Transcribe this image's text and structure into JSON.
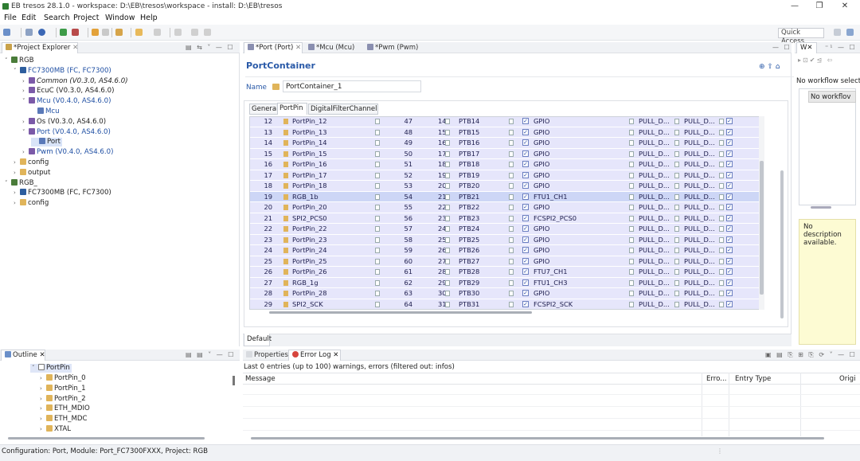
{
  "window": {
    "title": "EB tresos 28.1.0 - workspace: D:\\EB\\tresos\\workspace - install: D:\\EB\\tresos"
  },
  "menu": [
    "File",
    "Edit",
    "Search",
    "Project",
    "Window",
    "Help"
  ],
  "toolbar": {
    "quick_access": "Quick Access"
  },
  "explorer": {
    "tab": "*Project Explorer",
    "tree": [
      {
        "label": "RGB",
        "depth": 0,
        "arrow": "˅",
        "style": "normal"
      },
      {
        "label": "FC7300MB (FC, FC7300)",
        "depth": 1,
        "arrow": "˅",
        "style": "blue"
      },
      {
        "label": "Common (V0.3.0, AS4.6.0)",
        "depth": 2,
        "arrow": "›",
        "style": "italic"
      },
      {
        "label": "EcuC (V0.3.0, AS4.6.0)",
        "depth": 2,
        "arrow": "›",
        "style": "normal"
      },
      {
        "label": "Mcu (V0.4.0, AS4.6.0)",
        "depth": 2,
        "arrow": "˅",
        "style": "blue"
      },
      {
        "label": "Mcu",
        "depth": 3,
        "arrow": "",
        "style": "blue"
      },
      {
        "label": "Os (V0.3.0, AS4.6.0)",
        "depth": 2,
        "arrow": "›",
        "style": "normal"
      },
      {
        "label": "Port (V0.4.0, AS4.6.0)",
        "depth": 2,
        "arrow": "˅",
        "style": "blue"
      },
      {
        "label": "Port",
        "depth": 3,
        "arrow": "",
        "style": "selected"
      },
      {
        "label": "Pwm (V0.4.0, AS4.6.0)",
        "depth": 2,
        "arrow": "›",
        "style": "blue"
      },
      {
        "label": "config",
        "depth": 1,
        "arrow": "›",
        "style": "normal"
      },
      {
        "label": "output",
        "depth": 1,
        "arrow": "›",
        "style": "normal"
      },
      {
        "label": "RGB_",
        "depth": 0,
        "arrow": "˅",
        "style": "normal"
      },
      {
        "label": "FC7300MB (FC, FC7300)",
        "depth": 1,
        "arrow": "›",
        "style": "normal"
      },
      {
        "label": "config",
        "depth": 1,
        "arrow": "›",
        "style": "normal"
      }
    ]
  },
  "editor_tabs": [
    "*Port (Port)",
    "*Mcu (Mcu)",
    "*Pwm (Pwm)"
  ],
  "editor": {
    "heading": "PortContainer",
    "name_label": "Name",
    "name_value": "PortContainer_1",
    "subtabs": [
      "General",
      "PortPin",
      "DigitalFilterChannel"
    ],
    "footer_tab": "Default",
    "rows": [
      {
        "idx": "12",
        "name": "PortPin_12",
        "id": "47",
        "pin": "14",
        "port": "PTB14",
        "mode": "GPIO",
        "pull1": "PULL_D...",
        "pull2": "PULL_D..."
      },
      {
        "idx": "13",
        "name": "PortPin_13",
        "id": "48",
        "pin": "15",
        "port": "PTB15",
        "mode": "GPIO",
        "pull1": "PULL_D...",
        "pull2": "PULL_D..."
      },
      {
        "idx": "14",
        "name": "PortPin_14",
        "id": "49",
        "pin": "16",
        "port": "PTB16",
        "mode": "GPIO",
        "pull1": "PULL_D...",
        "pull2": "PULL_D..."
      },
      {
        "idx": "15",
        "name": "PortPin_15",
        "id": "50",
        "pin": "17",
        "port": "PTB17",
        "mode": "GPIO",
        "pull1": "PULL_D...",
        "pull2": "PULL_D..."
      },
      {
        "idx": "16",
        "name": "PortPin_16",
        "id": "51",
        "pin": "18",
        "port": "PTB18",
        "mode": "GPIO",
        "pull1": "PULL_D...",
        "pull2": "PULL_D..."
      },
      {
        "idx": "17",
        "name": "PortPin_17",
        "id": "52",
        "pin": "19",
        "port": "PTB19",
        "mode": "GPIO",
        "pull1": "PULL_D...",
        "pull2": "PULL_D..."
      },
      {
        "idx": "18",
        "name": "PortPin_18",
        "id": "53",
        "pin": "20",
        "port": "PTB20",
        "mode": "GPIO",
        "pull1": "PULL_D...",
        "pull2": "PULL_D..."
      },
      {
        "idx": "19",
        "name": "RGB_1b",
        "id": "54",
        "pin": "21",
        "port": "PTB21",
        "mode": "FTU1_CH1",
        "pull1": "PULL_D...",
        "pull2": "PULL_D...",
        "selected": true
      },
      {
        "idx": "20",
        "name": "PortPin_20",
        "id": "55",
        "pin": "22",
        "port": "PTB22",
        "mode": "GPIO",
        "pull1": "PULL_D...",
        "pull2": "PULL_D..."
      },
      {
        "idx": "21",
        "name": "SPI2_PCS0",
        "id": "56",
        "pin": "23",
        "port": "PTB23",
        "mode": "FCSPI2_PCS0",
        "pull1": "PULL_D...",
        "pull2": "PULL_D..."
      },
      {
        "idx": "22",
        "name": "PortPin_22",
        "id": "57",
        "pin": "24",
        "port": "PTB24",
        "mode": "GPIO",
        "pull1": "PULL_D...",
        "pull2": "PULL_D..."
      },
      {
        "idx": "23",
        "name": "PortPin_23",
        "id": "58",
        "pin": "25",
        "port": "PTB25",
        "mode": "GPIO",
        "pull1": "PULL_D...",
        "pull2": "PULL_D..."
      },
      {
        "idx": "24",
        "name": "PortPin_24",
        "id": "59",
        "pin": "26",
        "port": "PTB26",
        "mode": "GPIO",
        "pull1": "PULL_D...",
        "pull2": "PULL_D..."
      },
      {
        "idx": "25",
        "name": "PortPin_25",
        "id": "60",
        "pin": "27",
        "port": "PTB27",
        "mode": "GPIO",
        "pull1": "PULL_D...",
        "pull2": "PULL_D..."
      },
      {
        "idx": "26",
        "name": "PortPin_26",
        "id": "61",
        "pin": "28",
        "port": "PTB28",
        "mode": "FTU7_CH1",
        "pull1": "PULL_D...",
        "pull2": "PULL_D..."
      },
      {
        "idx": "27",
        "name": "RGB_1g",
        "id": "62",
        "pin": "29",
        "port": "PTB29",
        "mode": "FTU1_CH3",
        "pull1": "PULL_D...",
        "pull2": "PULL_D..."
      },
      {
        "idx": "28",
        "name": "PortPin_28",
        "id": "63",
        "pin": "30",
        "port": "PTB30",
        "mode": "GPIO",
        "pull1": "PULL_D...",
        "pull2": "PULL_D..."
      },
      {
        "idx": "29",
        "name": "SPI2_SCK",
        "id": "64",
        "pin": "31",
        "port": "PTB31",
        "mode": "FCSPI2_SCK",
        "pull1": "PULL_D...",
        "pull2": "PULL_D..."
      }
    ]
  },
  "workflow": {
    "tab": "W",
    "title": "No workflow select",
    "button": "No workflov",
    "desc": "No description available."
  },
  "outline": {
    "tab": "Outline",
    "root": "PortPin",
    "items": [
      "PortPin_0",
      "PortPin_1",
      "PortPin_2",
      "ETH_MDIO",
      "ETH_MDC",
      "XTAL"
    ]
  },
  "errlog": {
    "tabs": [
      "Properties",
      "Error Log"
    ],
    "summary": "Last 0 entries (up to 100) warnings, errors (filtered out: infos)",
    "columns": [
      "Message",
      "Erro...",
      "Entry Type",
      "Origi"
    ]
  },
  "status": {
    "text": "Configuration: Port, Module: Port_FC7300FXXX, Project: RGB"
  },
  "colors": {
    "row_bg": "#e6e6fb",
    "row_selected": "#cdd6f6",
    "accent": "#1f4fa3",
    "panel_bg": "#f0f2f5"
  }
}
